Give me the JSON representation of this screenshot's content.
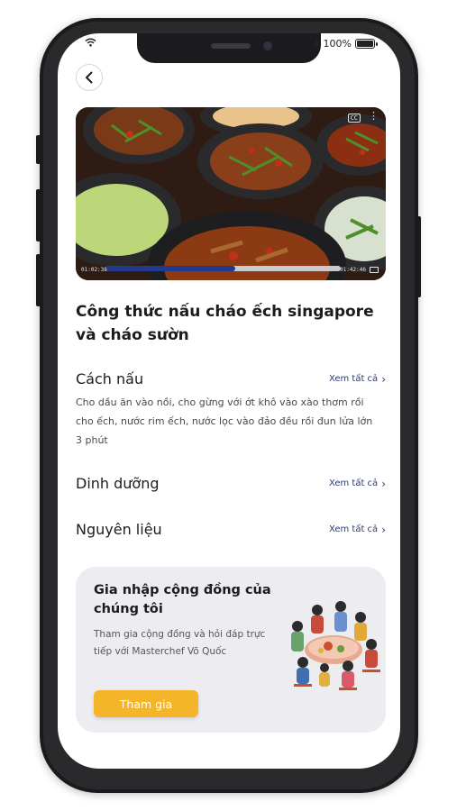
{
  "status_bar": {
    "battery": "100%"
  },
  "video": {
    "elapsed": "01:02:38",
    "duration": "01:42:46",
    "progress": 0.55,
    "cc_label": "CC"
  },
  "recipe": {
    "title": "Công thức nấu cháo ếch singapore và cháo sườn"
  },
  "sections": {
    "see_all": "Xem tất cả",
    "cooking": {
      "title": "Cách nấu",
      "description": "Cho dầu ăn vào nồi, cho gừng với ớt khô vào xào thơm rồi cho ếch, nước rim ếch, nước lọc vào đảo đều rồi đun lửa lớn 3 phút"
    },
    "nutrition": {
      "title": "Dinh dưỡng"
    },
    "ingredients": {
      "title": "Nguyên liệu"
    }
  },
  "community": {
    "title": "Gia nhập cộng đồng của chúng tôi",
    "description": "Tham gia cộng đồng và hỏi đáp trực tiếp với Masterchef Võ Quốc",
    "button": "Tham gia"
  },
  "colors": {
    "accent": "#f5b52a",
    "link": "#2d3b6e",
    "card_bg": "#ececf1",
    "progress": "#223a8c"
  }
}
